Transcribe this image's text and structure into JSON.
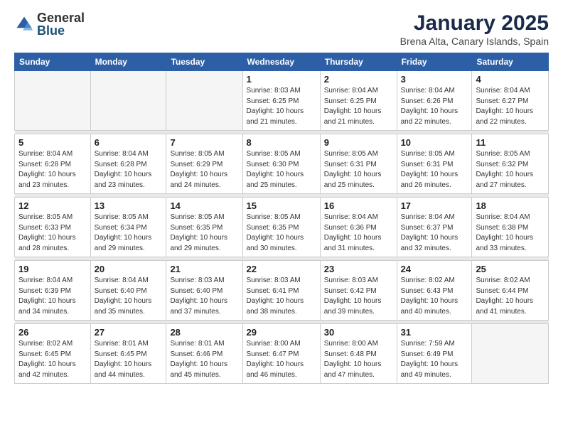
{
  "header": {
    "logo_general": "General",
    "logo_blue": "Blue",
    "month_title": "January 2025",
    "location": "Brena Alta, Canary Islands, Spain"
  },
  "weekdays": [
    "Sunday",
    "Monday",
    "Tuesday",
    "Wednesday",
    "Thursday",
    "Friday",
    "Saturday"
  ],
  "weeks": [
    {
      "days": [
        {
          "num": "",
          "info": ""
        },
        {
          "num": "",
          "info": ""
        },
        {
          "num": "",
          "info": ""
        },
        {
          "num": "1",
          "info": "Sunrise: 8:03 AM\nSunset: 6:25 PM\nDaylight: 10 hours\nand 21 minutes."
        },
        {
          "num": "2",
          "info": "Sunrise: 8:04 AM\nSunset: 6:25 PM\nDaylight: 10 hours\nand 21 minutes."
        },
        {
          "num": "3",
          "info": "Sunrise: 8:04 AM\nSunset: 6:26 PM\nDaylight: 10 hours\nand 22 minutes."
        },
        {
          "num": "4",
          "info": "Sunrise: 8:04 AM\nSunset: 6:27 PM\nDaylight: 10 hours\nand 22 minutes."
        }
      ]
    },
    {
      "days": [
        {
          "num": "5",
          "info": "Sunrise: 8:04 AM\nSunset: 6:28 PM\nDaylight: 10 hours\nand 23 minutes."
        },
        {
          "num": "6",
          "info": "Sunrise: 8:04 AM\nSunset: 6:28 PM\nDaylight: 10 hours\nand 23 minutes."
        },
        {
          "num": "7",
          "info": "Sunrise: 8:05 AM\nSunset: 6:29 PM\nDaylight: 10 hours\nand 24 minutes."
        },
        {
          "num": "8",
          "info": "Sunrise: 8:05 AM\nSunset: 6:30 PM\nDaylight: 10 hours\nand 25 minutes."
        },
        {
          "num": "9",
          "info": "Sunrise: 8:05 AM\nSunset: 6:31 PM\nDaylight: 10 hours\nand 25 minutes."
        },
        {
          "num": "10",
          "info": "Sunrise: 8:05 AM\nSunset: 6:31 PM\nDaylight: 10 hours\nand 26 minutes."
        },
        {
          "num": "11",
          "info": "Sunrise: 8:05 AM\nSunset: 6:32 PM\nDaylight: 10 hours\nand 27 minutes."
        }
      ]
    },
    {
      "days": [
        {
          "num": "12",
          "info": "Sunrise: 8:05 AM\nSunset: 6:33 PM\nDaylight: 10 hours\nand 28 minutes."
        },
        {
          "num": "13",
          "info": "Sunrise: 8:05 AM\nSunset: 6:34 PM\nDaylight: 10 hours\nand 29 minutes."
        },
        {
          "num": "14",
          "info": "Sunrise: 8:05 AM\nSunset: 6:35 PM\nDaylight: 10 hours\nand 29 minutes."
        },
        {
          "num": "15",
          "info": "Sunrise: 8:05 AM\nSunset: 6:35 PM\nDaylight: 10 hours\nand 30 minutes."
        },
        {
          "num": "16",
          "info": "Sunrise: 8:04 AM\nSunset: 6:36 PM\nDaylight: 10 hours\nand 31 minutes."
        },
        {
          "num": "17",
          "info": "Sunrise: 8:04 AM\nSunset: 6:37 PM\nDaylight: 10 hours\nand 32 minutes."
        },
        {
          "num": "18",
          "info": "Sunrise: 8:04 AM\nSunset: 6:38 PM\nDaylight: 10 hours\nand 33 minutes."
        }
      ]
    },
    {
      "days": [
        {
          "num": "19",
          "info": "Sunrise: 8:04 AM\nSunset: 6:39 PM\nDaylight: 10 hours\nand 34 minutes."
        },
        {
          "num": "20",
          "info": "Sunrise: 8:04 AM\nSunset: 6:40 PM\nDaylight: 10 hours\nand 35 minutes."
        },
        {
          "num": "21",
          "info": "Sunrise: 8:03 AM\nSunset: 6:40 PM\nDaylight: 10 hours\nand 37 minutes."
        },
        {
          "num": "22",
          "info": "Sunrise: 8:03 AM\nSunset: 6:41 PM\nDaylight: 10 hours\nand 38 minutes."
        },
        {
          "num": "23",
          "info": "Sunrise: 8:03 AM\nSunset: 6:42 PM\nDaylight: 10 hours\nand 39 minutes."
        },
        {
          "num": "24",
          "info": "Sunrise: 8:02 AM\nSunset: 6:43 PM\nDaylight: 10 hours\nand 40 minutes."
        },
        {
          "num": "25",
          "info": "Sunrise: 8:02 AM\nSunset: 6:44 PM\nDaylight: 10 hours\nand 41 minutes."
        }
      ]
    },
    {
      "days": [
        {
          "num": "26",
          "info": "Sunrise: 8:02 AM\nSunset: 6:45 PM\nDaylight: 10 hours\nand 42 minutes."
        },
        {
          "num": "27",
          "info": "Sunrise: 8:01 AM\nSunset: 6:45 PM\nDaylight: 10 hours\nand 44 minutes."
        },
        {
          "num": "28",
          "info": "Sunrise: 8:01 AM\nSunset: 6:46 PM\nDaylight: 10 hours\nand 45 minutes."
        },
        {
          "num": "29",
          "info": "Sunrise: 8:00 AM\nSunset: 6:47 PM\nDaylight: 10 hours\nand 46 minutes."
        },
        {
          "num": "30",
          "info": "Sunrise: 8:00 AM\nSunset: 6:48 PM\nDaylight: 10 hours\nand 47 minutes."
        },
        {
          "num": "31",
          "info": "Sunrise: 7:59 AM\nSunset: 6:49 PM\nDaylight: 10 hours\nand 49 minutes."
        },
        {
          "num": "",
          "info": ""
        }
      ]
    }
  ]
}
